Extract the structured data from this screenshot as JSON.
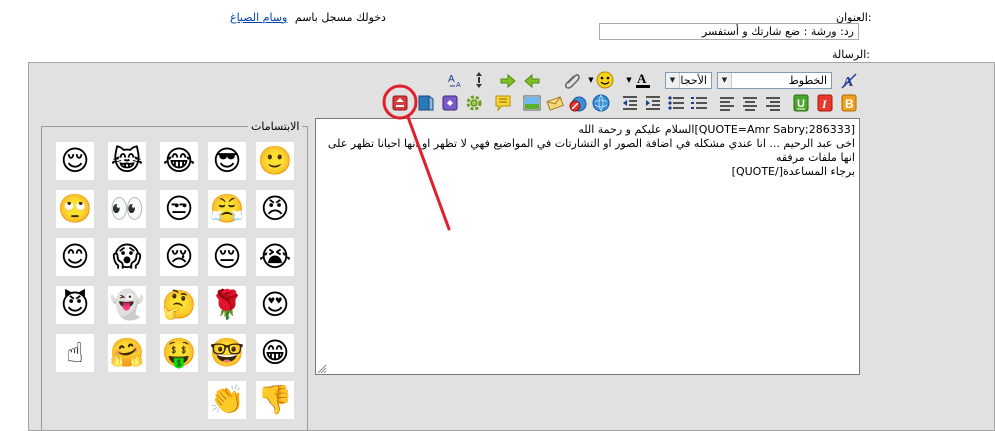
{
  "header": {
    "logged_in_prefix": "دخولك مسجل باسم",
    "username": "وسام الصباغ"
  },
  "form": {
    "title_label": "العنوان:",
    "title_value": "رد: ورشة : ضع شارتك و أستفسر",
    "message_label": "الرسالة:"
  },
  "toolbar": {
    "font_select": "الخطوط",
    "size_select": "الأحجا",
    "row1_icons": [
      "font-size-swap-icon",
      "resize-arrows-icon",
      "arrow-right-icon",
      "arrow-left-icon",
      "attachment-icon",
      "smiley-icon",
      "font-color-icon",
      "font-face-icon",
      "remove-format-icon"
    ],
    "row2_icons": [
      "wrap-code-icon",
      "media-icon",
      "wrap-php-icon",
      "settings-icon",
      "comment-icon",
      "image-icon",
      "email-icon",
      "unlink-icon",
      "link-icon",
      "outdent-icon",
      "indent-icon",
      "bullet-list-icon",
      "number-list-icon",
      "align-left-icon",
      "align-center-icon",
      "align-right-icon",
      "underline-icon",
      "italic-icon",
      "bold-icon"
    ]
  },
  "editor": {
    "content": "[QUOTE=Amr Sabry;286333]السلام عليكم و رحمة الله\nاخى عبد الرحيم ... انا عندي مشكله في اضافة الصور او التشارتات في المواضيع فهي لا تظهر او انها احيانا تظهر على انها ملفات مرفقه\nبرجاء المساعدة[/QUOTE]"
  },
  "smilies": {
    "legend": "الابتسامات",
    "items": [
      "🙂",
      "😎",
      "😂",
      "😹",
      "😌",
      "😠",
      "😤",
      "😒",
      "👀",
      "🙄",
      "😭",
      "😔",
      "😢",
      "😱",
      "😊",
      "😍",
      "🌹",
      "🤔",
      "👻",
      "😈",
      "😁",
      "🤓",
      "🤑",
      "🤗",
      "☝",
      "👎",
      "👏"
    ]
  },
  "colors": {
    "panel_bg": "#e1e1e1",
    "annotation": "#e0202a",
    "link": "#0044aa"
  }
}
